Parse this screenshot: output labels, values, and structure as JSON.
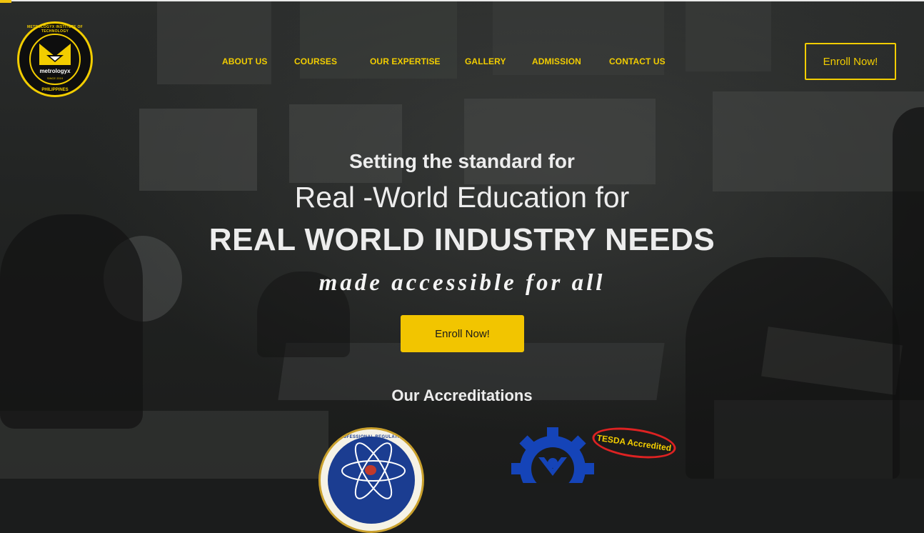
{
  "logo": {
    "ring_top_text": "METROLOGYX INSTITUTE OF TECHNOLOGY",
    "wordmark": "metrologyx",
    "est": "SINCE 2019",
    "ring_bottom_text": "PHILIPPINES"
  },
  "nav": {
    "items": [
      {
        "label": "ABOUT US"
      },
      {
        "label": "COURSES"
      },
      {
        "label": "OUR EXPERTISE"
      },
      {
        "label": "GALLERY"
      },
      {
        "label": "ADMISSION"
      },
      {
        "label": "CONTACT US"
      }
    ],
    "cta_label": "Enroll Now!"
  },
  "hero": {
    "line1": "Setting the standard for",
    "line2": "Real -World Education for",
    "line3": "REAL WORLD INDUSTRY NEEDS",
    "tagline": "made accessible for all",
    "cta_label": "Enroll Now!"
  },
  "accreditations": {
    "heading": "Our Accreditations",
    "prc_text": "PROFESSIONAL REGULATION COMMISSION",
    "tesda_badge": "TESDA Accredited"
  },
  "colors": {
    "accent": "#f2cd00",
    "button_fill": "#f2c500",
    "text": "#ededed"
  }
}
